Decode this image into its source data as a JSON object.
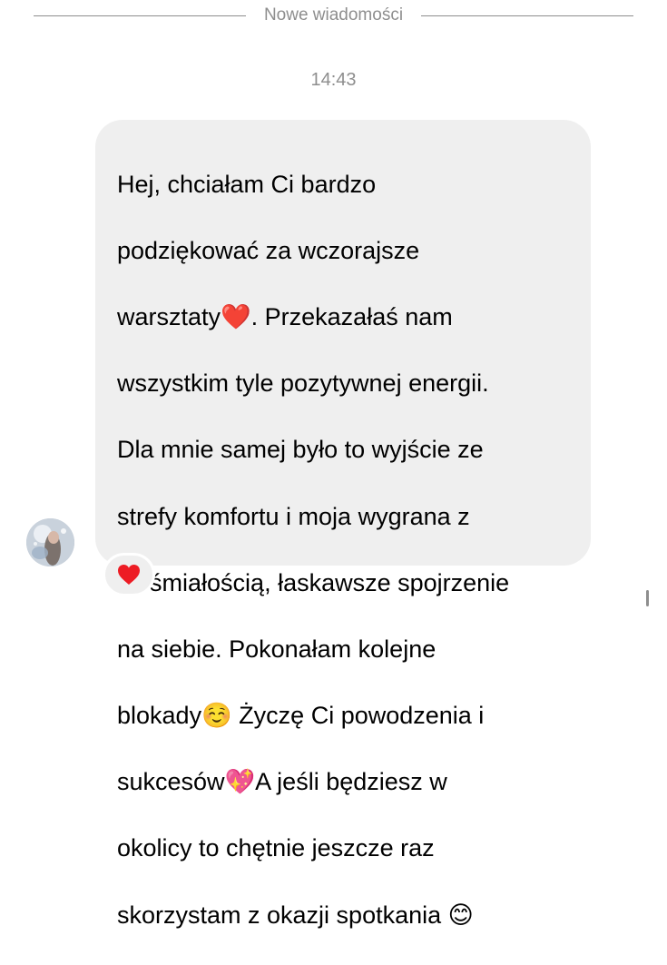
{
  "divider": {
    "label": "Nowe wiadomości"
  },
  "timestamp": "14:43",
  "message": {
    "lines": [
      "Hej, chciałam Ci bardzo",
      "podziękować za wczorajsze",
      "warsztaty❤️. Przekazałaś nam",
      "wszystkim tyle pozytywnej energii.",
      "Dla mnie samej było to wyjście ze",
      "strefy komfortu i moja wygrana z",
      "nieśmiałością, łaskawsze spojrzenie",
      "na siebie. Pokonałam kolejne",
      "blokady☺️ Życzę Ci powodzenia i",
      "sukcesów💖A jeśli będziesz w",
      "okolicy to chętnie jeszcze raz",
      "skorzystam z okazji spotkania 😊"
    ]
  },
  "reaction": {
    "icon": "heart-icon",
    "color": "#ed1c24"
  },
  "colors": {
    "bubble": "#efefef",
    "meta_text": "#8e8e8e"
  }
}
